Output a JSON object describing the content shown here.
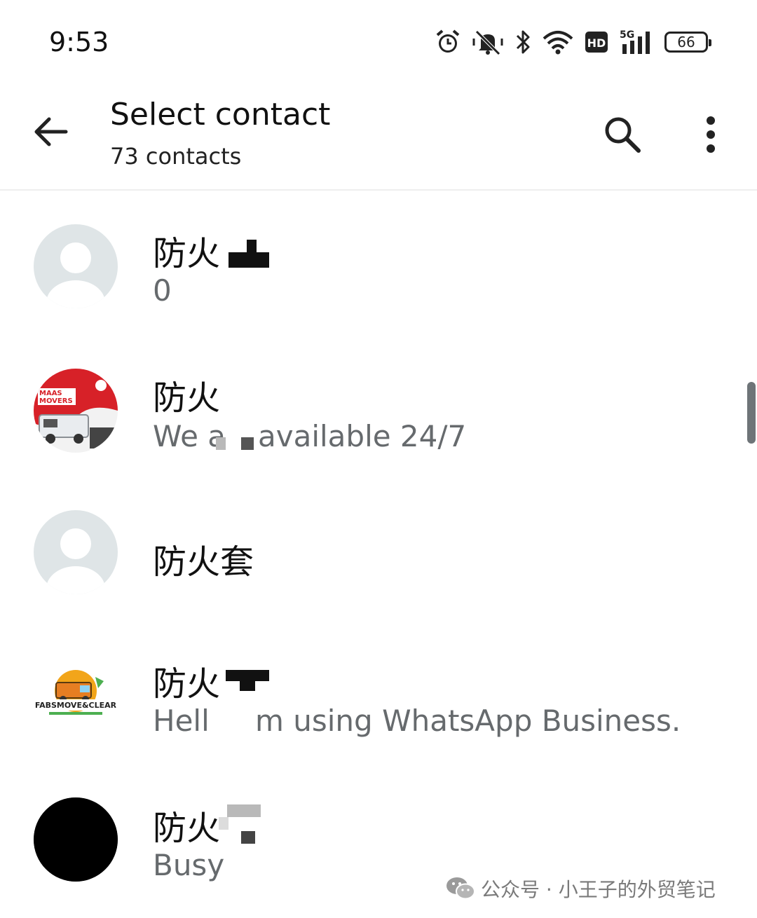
{
  "status_bar": {
    "time": "9:53",
    "icons": [
      "alarm-icon",
      "silent-icon",
      "bluetooth-icon",
      "wifi-icon",
      "hd-icon",
      "5g-signal-icon"
    ],
    "hd_label": "HD",
    "network_label": "5G",
    "battery_level": "66"
  },
  "app_bar": {
    "title": "Select contact",
    "subtitle": "73 contacts",
    "back_icon": "arrow-left-icon",
    "search_icon": "search-icon",
    "more_icon": "more-vert-icon"
  },
  "contacts": [
    {
      "name": "防火",
      "status": "0",
      "avatar": "default-person-icon"
    },
    {
      "name": "防火",
      "status_start": "We a",
      "status_end": "available 24/7",
      "avatar": "maas-movers-logo"
    },
    {
      "name": "防火套",
      "status": "",
      "avatar": "default-person-icon"
    },
    {
      "name": "防火",
      "status_start": "Hell",
      "status_end": "m using WhatsApp Business.",
      "avatar": "fabsmove-clear-logo"
    },
    {
      "name": "防火",
      "status": "Busy",
      "avatar": "black-avatar"
    }
  ],
  "watermark": {
    "text": "公众号 · 小王子的外贸笔记",
    "icon": "wechat-icon"
  },
  "colors": {
    "background": "#ffffff",
    "text_primary": "#111111",
    "text_secondary": "#666a6d",
    "avatar_placeholder": "#dfe5e7",
    "divider": "#eeeeee"
  }
}
